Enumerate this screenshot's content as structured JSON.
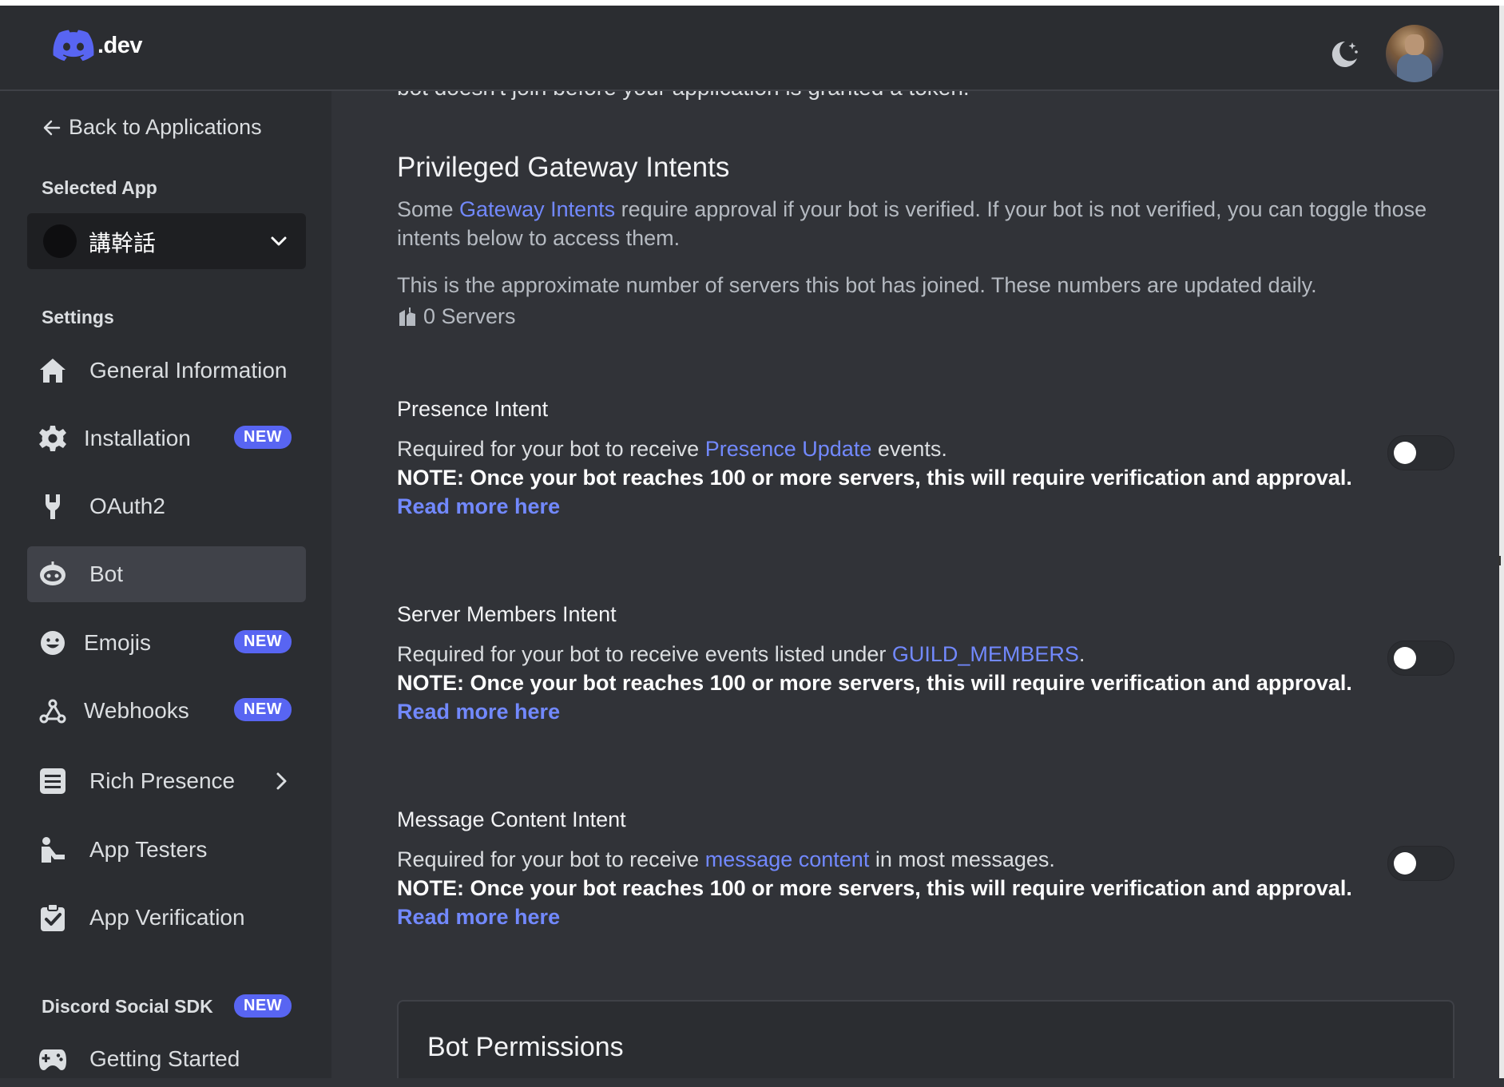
{
  "header": {
    "logo_text": ".dev",
    "theme_toggle_icon": "moon-stars-icon",
    "avatar_icon": "user-avatar"
  },
  "sidebar": {
    "back_label": "Back to Applications",
    "selected_app_label": "Selected App",
    "selected_app_name": "講幹話",
    "settings_label": "Settings",
    "items": [
      {
        "label": "General Information",
        "icon": "home-icon"
      },
      {
        "label": "Installation",
        "icon": "gear-icon",
        "badge": "NEW"
      },
      {
        "label": "OAuth2",
        "icon": "wrench-icon"
      },
      {
        "label": "Bot",
        "icon": "robot-icon",
        "active": true
      },
      {
        "label": "Emojis",
        "icon": "smiley-icon",
        "badge": "NEW"
      },
      {
        "label": "Webhooks",
        "icon": "webhook-icon",
        "badge": "NEW"
      },
      {
        "label": "Rich Presence",
        "icon": "list-icon"
      },
      {
        "label": "App Testers",
        "icon": "tester-icon"
      },
      {
        "label": "App Verification",
        "icon": "clipboard-check-icon"
      }
    ],
    "sdk_label": "Discord Social SDK",
    "sdk_badge": "NEW",
    "sdk_items": [
      {
        "label": "Getting Started",
        "icon": "gamepad-icon"
      }
    ]
  },
  "main": {
    "cut_text": "bot doesn't join before your application is granted a token.",
    "section_title": "Privileged Gateway Intents",
    "intro_before": "Some ",
    "intro_link": "Gateway Intents",
    "intro_after": " require approval if your bot is verified. If your bot is not verified, you can toggle those intents below to access them.",
    "approx_text": "This is the approximate number of servers this bot has joined. These numbers are updated daily.",
    "servers_text": "0 Servers",
    "intents": [
      {
        "title": "Presence Intent",
        "desc_before": "Required for your bot to receive ",
        "desc_link": "Presence Update",
        "desc_after": " events.",
        "note": "NOTE: Once your bot reaches 100 or more servers, this will require verification and approval.",
        "read_more": "Read more here",
        "enabled": false
      },
      {
        "title": "Server Members Intent",
        "desc_before": "Required for your bot to receive events listed under ",
        "desc_link": "GUILD_MEMBERS",
        "desc_after": ".",
        "note": "NOTE: Once your bot reaches 100 or more servers, this will require verification and approval.",
        "read_more": "Read more here",
        "enabled": false
      },
      {
        "title": "Message Content Intent",
        "desc_before": "Required for your bot to receive ",
        "desc_link": "message content",
        "desc_after": " in most messages.",
        "note": "NOTE: Once your bot reaches 100 or more servers, this will require verification and approval.",
        "read_more": "Read more here",
        "enabled": false
      }
    ],
    "bot_permissions_title": "Bot Permissions"
  },
  "colors": {
    "background": "#313338",
    "sidebar": "#2b2d31",
    "accent": "#5865f2",
    "link": "#7289ff"
  }
}
